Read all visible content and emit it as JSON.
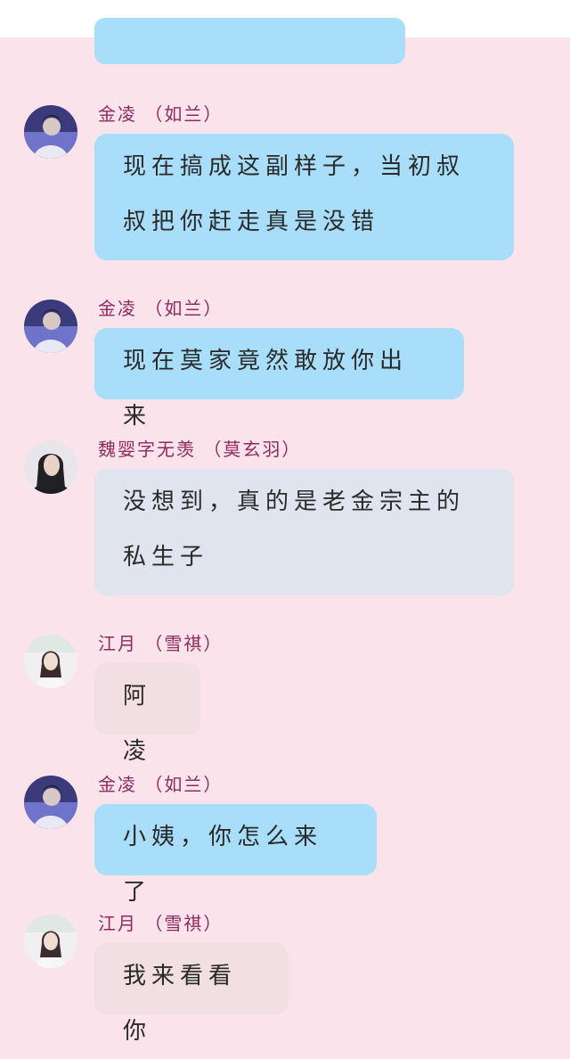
{
  "messages": [
    {
      "sender": "金凌 （如兰）",
      "text": "现在搞成这副样子，当初叔叔把你赶走真是没错",
      "avatar": "avatar-jinling-icon",
      "bubble_color": "#a8def9"
    },
    {
      "sender": "金凌 （如兰）",
      "text": "现在莫家竟然敢放你出来",
      "avatar": "avatar-jinling-icon",
      "bubble_color": "#a8def9"
    },
    {
      "sender": "魏婴字无羡 （莫玄羽）",
      "text": "没想到，真的是老金宗主的私生子",
      "avatar": "avatar-weiying-icon",
      "bubble_color": "#dfe4ee"
    },
    {
      "sender": "江月 （雪祺）",
      "text": "阿凌",
      "avatar": "avatar-jiangyue-icon",
      "bubble_color": "#f2dfe3"
    },
    {
      "sender": "金凌 （如兰）",
      "text": "小姨，你怎么来了",
      "avatar": "avatar-jinling-icon",
      "bubble_color": "#a8def9"
    },
    {
      "sender": "江月 （雪祺）",
      "text": "我来看看你",
      "avatar": "avatar-jiangyue-icon",
      "bubble_color": "#f2dfe3"
    }
  ],
  "colors": {
    "background": "#fbe3ec",
    "sender_name": "#8e2a5e",
    "bubble_blue": "#a8def9",
    "bubble_gray": "#dfe4ee",
    "bubble_pink": "#f2dfe3"
  }
}
